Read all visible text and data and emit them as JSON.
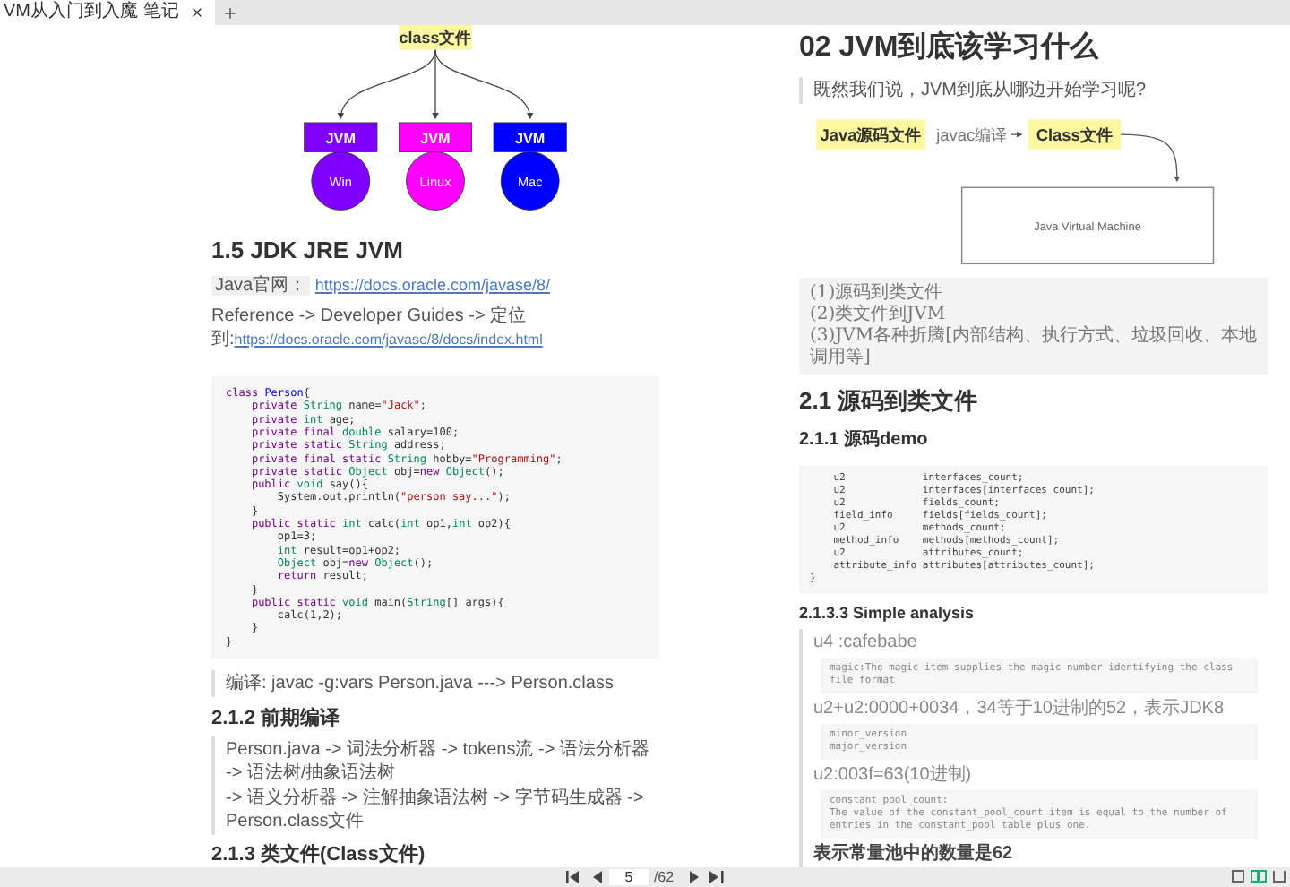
{
  "tab_bar": {
    "tabs": [
      {
        "title": "VM从入门到入魔 笔记",
        "selected": true
      }
    ]
  },
  "left_page": {
    "diagram": {
      "root": "class文件",
      "nodes": [
        {
          "label": "JVM",
          "platform": "Win",
          "color": "#7f00ff"
        },
        {
          "label": "JVM",
          "platform": "Linux",
          "color": "#ff00ff"
        },
        {
          "label": "JVM",
          "platform": "Mac",
          "color": "#0000ff"
        }
      ]
    },
    "heading": "1.5 JDK JRE JVM",
    "official_site": {
      "label": "Java官网：",
      "link": "https://docs.oracle.com/javase/8/"
    },
    "reference": {
      "text": "Reference -> Developer Guides -> 定位到:",
      "link": "https://docs.oracle.com/javase/8/docs/index.html"
    },
    "code": [
      [
        {
          "text": "class ",
          "kind": "kw"
        },
        {
          "text": "Person",
          "kind": "def"
        },
        {
          "text": "{",
          "kind": "plain"
        }
      ],
      [
        {
          "text": "    private ",
          "kind": "kw"
        },
        {
          "text": "String",
          "kind": "type"
        },
        {
          "text": " name=",
          "kind": "plain"
        },
        {
          "text": "\"Jack\"",
          "kind": "str"
        },
        {
          "text": ";",
          "kind": "plain"
        }
      ],
      [
        {
          "text": "    private ",
          "kind": "kw"
        },
        {
          "text": "int",
          "kind": "type"
        },
        {
          "text": " age;",
          "kind": "plain"
        }
      ],
      [
        {
          "text": "    private final ",
          "kind": "kw"
        },
        {
          "text": "double",
          "kind": "type"
        },
        {
          "text": " salary=100;",
          "kind": "plain"
        }
      ],
      [
        {
          "text": "    private static ",
          "kind": "kw"
        },
        {
          "text": "String",
          "kind": "type"
        },
        {
          "text": " address;",
          "kind": "plain"
        }
      ],
      [
        {
          "text": "    private final static ",
          "kind": "kw"
        },
        {
          "text": "String",
          "kind": "type"
        },
        {
          "text": " hobby=",
          "kind": "plain"
        },
        {
          "text": "\"Programming\"",
          "kind": "str"
        },
        {
          "text": ";",
          "kind": "plain"
        }
      ],
      [
        {
          "text": "    private static ",
          "kind": "kw"
        },
        {
          "text": "Object",
          "kind": "type"
        },
        {
          "text": " obj=",
          "kind": "plain"
        },
        {
          "text": "new ",
          "kind": "kw"
        },
        {
          "text": "Object",
          "kind": "type"
        },
        {
          "text": "();",
          "kind": "plain"
        }
      ],
      [
        {
          "text": "    public ",
          "kind": "kw"
        },
        {
          "text": "void",
          "kind": "type"
        },
        {
          "text": " say(){",
          "kind": "plain"
        }
      ],
      [
        {
          "text": "        System.out.println(",
          "kind": "plain"
        },
        {
          "text": "\"person say...\"",
          "kind": "str"
        },
        {
          "text": ");",
          "kind": "plain"
        }
      ],
      [
        {
          "text": "    }",
          "kind": "plain"
        }
      ],
      [
        {
          "text": "    public static ",
          "kind": "kw"
        },
        {
          "text": "int",
          "kind": "type"
        },
        {
          "text": " calc(",
          "kind": "plain"
        },
        {
          "text": "int",
          "kind": "type"
        },
        {
          "text": " op1,",
          "kind": "plain"
        },
        {
          "text": "int",
          "kind": "type"
        },
        {
          "text": " op2){",
          "kind": "plain"
        }
      ],
      [
        {
          "text": "        op1=3;",
          "kind": "plain"
        }
      ],
      [
        {
          "text": "        int",
          "kind": "type"
        },
        {
          "text": " result=op1+op2;",
          "kind": "plain"
        }
      ],
      [
        {
          "text": "        Object",
          "kind": "type"
        },
        {
          "text": " obj=",
          "kind": "plain"
        },
        {
          "text": "new ",
          "kind": "kw"
        },
        {
          "text": "Object",
          "kind": "type"
        },
        {
          "text": "();",
          "kind": "plain"
        }
      ],
      [
        {
          "text": "        return",
          "kind": "kw"
        },
        {
          "text": " result;",
          "kind": "plain"
        }
      ],
      [
        {
          "text": "    }",
          "kind": "plain"
        }
      ],
      [
        {
          "text": "    public static ",
          "kind": "kw"
        },
        {
          "text": "void",
          "kind": "type"
        },
        {
          "text": " main(",
          "kind": "plain"
        },
        {
          "text": "String",
          "kind": "type"
        },
        {
          "text": "[] args){",
          "kind": "plain"
        }
      ],
      [
        {
          "text": "        calc(1,2);",
          "kind": "plain"
        }
      ],
      [
        {
          "text": "    }",
          "kind": "plain"
        }
      ],
      [
        {
          "text": "}",
          "kind": "plain"
        }
      ]
    ],
    "compile_note": "编译: javac -g:vars Person.java ---> Person.class",
    "heading_2": "2.1.2 前期编译",
    "pipeline": [
      "Person.java -> 词法分析器 -> tokens流 -> 语法分析器 -> 语法树/抽象语法树",
      "-> 语义分析器 -> 注解抽象语法树 -> 字节码生成器 -> Person.class文件"
    ],
    "heading_3": "2.1.3 类文件(Class文件)"
  },
  "right_page": {
    "title": "02 JVM到底该学习什么",
    "intro": "既然我们说，JVM到底从哪边开始学习呢?",
    "flow": {
      "source": "Java源码文件",
      "edge": "javac编译",
      "target": "Class文件",
      "machine": "Java Virtual Machine"
    },
    "steps": [
      "(1)源码到类文件",
      "(2)类文件到JVM",
      "(3)JVM各种折腾[内部结构、执行方式、垃圾回收、本地调用等]"
    ],
    "heading": "2.1 源码到类文件",
    "subheading": "2.1.1 源码demo",
    "code": [
      "    u2             interfaces_count;",
      "    u2             interfaces[interfaces_count];",
      "    u2             fields_count;",
      "    field_info     fields[fields_count];",
      "    u2             methods_count;",
      "    method_info    methods[methods_count];",
      "    u2             attributes_count;",
      "    attribute_info attributes[attributes_count];",
      "}"
    ],
    "analysis_heading": "2.1.3.3 Simple analysis",
    "analysis": [
      {
        "note": "u4 :cafebabe",
        "code": [
          "magic:The magic item supplies the magic number identifying the class file format"
        ]
      },
      {
        "note": "u2+u2:0000+0034，34等于10进制的52，表示JDK8",
        "code": [
          "minor_version",
          "major_version"
        ]
      },
      {
        "note": "u2:003f=63(10进制)",
        "code": [
          "constant_pool_count:",
          "The value of the constant_pool_count item is equal to the number of entries in the constant_pool table plus one."
        ]
      }
    ],
    "conclusion": "表示常量池中的数量是62"
  },
  "toolbar": {
    "page": "5",
    "total": "/62"
  }
}
